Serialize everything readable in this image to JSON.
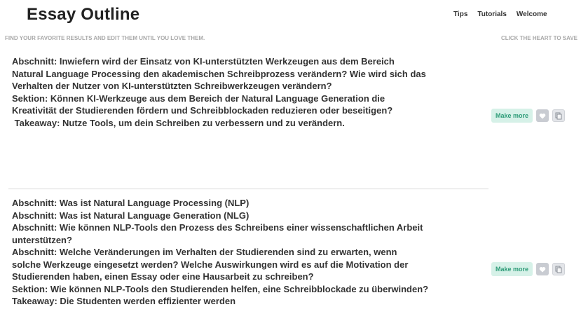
{
  "header": {
    "title": "Essay Outline",
    "nav": [
      "Tips",
      "Tutorials",
      "Welcome"
    ]
  },
  "hints": {
    "left": "FIND YOUR FAVORITE RESULTS AND EDIT THEM UNTIL YOU LOVE THEM.",
    "right": "CLICK THE HEART TO SAVE"
  },
  "results": [
    {
      "lines": [
        "Abschnitt: Inwiefern wird der Einsatz von KI-unterstützten Werkzeugen aus dem Bereich",
        "Natural Language Processing den akademischen Schreibprozess verändern? Wie wird sich das",
        "Verhalten der Nutzer von KI-unterstützten Schreibwerkzeugen verändern?",
        "Sektion: Können KI-Werkzeuge aus dem Bereich der Natural Language Generation die",
        "Kreativität der Studierenden fördern und Schreibblockaden reduzieren oder beseitigen?",
        " Takeaway: Nutze Tools, um dein Schreiben zu verbessern und zu verändern."
      ],
      "make_more_label": "Make more"
    },
    {
      "lines": [
        "Abschnitt: Was ist Natural Language Processing (NLP)",
        "Abschnitt: Was ist Natural Language Generation (NLG)",
        "Abschnitt: Wie können NLP-Tools den Prozess des Schreibens einer wissenschaftlichen Arbeit",
        "unterstützen?",
        "Abschnitt: Welche Veränderungen im Verhalten der Studierenden sind zu erwarten, wenn",
        "solche Werkzeuge eingesetzt werden? Welche Auswirkungen wird es auf die Motivation der",
        "Studierenden haben, einen Essay oder eine Hausarbeit zu schreiben?",
        "Sektion: Wie können NLP-Tools den Studierenden helfen, eine Schreibblockade zu überwinden?",
        "Takeaway: Die Studenten werden effizienter werden"
      ],
      "make_more_label": "Make more"
    }
  ],
  "colors": {
    "make_more_bg": "#d6f1e8",
    "make_more_text": "#2e9c78",
    "icon_bg": "#c9ccd2"
  },
  "icons": [
    "heart-icon",
    "copy-icon"
  ]
}
